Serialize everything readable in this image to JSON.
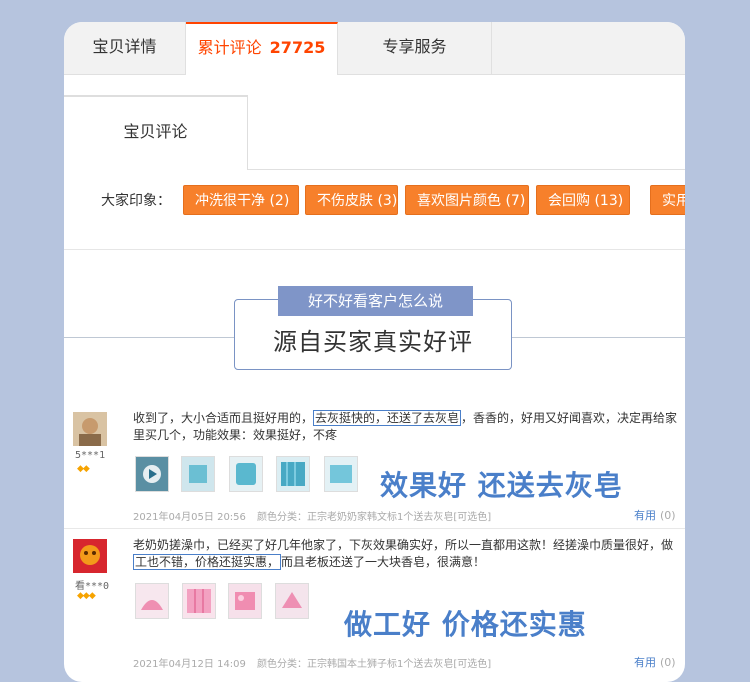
{
  "tabs": {
    "details": "宝贝详情",
    "reviews_label": "累计评论",
    "reviews_count": "27725",
    "service": "专享服务"
  },
  "subtab": {
    "label": "宝贝评论"
  },
  "impressions": {
    "label": "大家印象：",
    "tags": [
      "冲洗很干净 (2)",
      "不伤皮肤 (3)",
      "喜欢图片颜色 (7)",
      "会回购 (13)",
      "实用"
    ]
  },
  "banner": {
    "pill": "好不好看客户怎么说",
    "title": "源自买家真实好评"
  },
  "reviews": [
    {
      "user": "5***1",
      "text_before": "收到了，大小合适而且挺好用的，",
      "highlight": "去灰挺快的，还送了去灰皂",
      "text_after": "，香香的，好用又好闻喜欢，决定再给家里买几个，功能效果：效果挺好，不疼",
      "big_tag": "效果好 还送去灰皂",
      "date": "2021年04月05日 20:56",
      "variant": "颜色分类：正宗老奶奶家韩文标1个送去灰皂[可选色]",
      "useful_label": "有用",
      "useful_count": "(0)",
      "thumb_colors": [
        "#5bb5c9",
        "#c8e3ea",
        "#6cc4d9",
        "#4aa8c2",
        "#77c7dd"
      ]
    },
    {
      "user": "看***0",
      "text_line1": "老奶奶搓澡巾，已经买了好几年他家了，下灰效果确实好，所以一直都用这款！经搓澡巾质量很好，做",
      "highlight": "工也不错，价格还挺实惠，",
      "text_after": "而且老板还送了一大块香皂，很满意！",
      "big_tag": "做工好 价格还实惠",
      "date": "2021年04月12日 14:09",
      "variant": "颜色分类：正宗韩国本土狮子标1个送去灰皂[可选色]",
      "useful_label": "有用",
      "useful_count": "(0)",
      "thumb_colors": [
        "#f3a6c3",
        "#f08db1",
        "#f6b3cc",
        "#ee8fb3"
      ]
    }
  ]
}
